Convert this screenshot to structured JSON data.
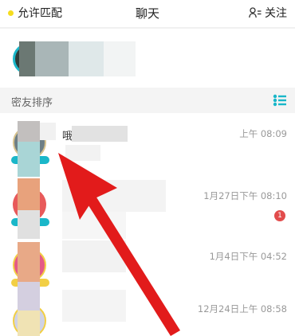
{
  "header": {
    "left_label": "允许匹配",
    "title": "聊天",
    "right_label": "关注",
    "dot_color": "#f5dc1e"
  },
  "section": {
    "label": "密友排序",
    "icon": "list-icon",
    "accent_color": "#1ab7c9"
  },
  "chats": [
    {
      "name": "哦",
      "time": "上午 08:09",
      "unread": null
    },
    {
      "name": "",
      "time": "1月27日下午 08:10",
      "unread": "1"
    },
    {
      "name": "",
      "time": "1月4日下午 04:52",
      "unread": null
    },
    {
      "name": "",
      "time": "12月24日上午 08:58",
      "unread": null
    }
  ],
  "colors": {
    "arrow": "#e21b1b",
    "unread_badge": "#e24c4c"
  }
}
